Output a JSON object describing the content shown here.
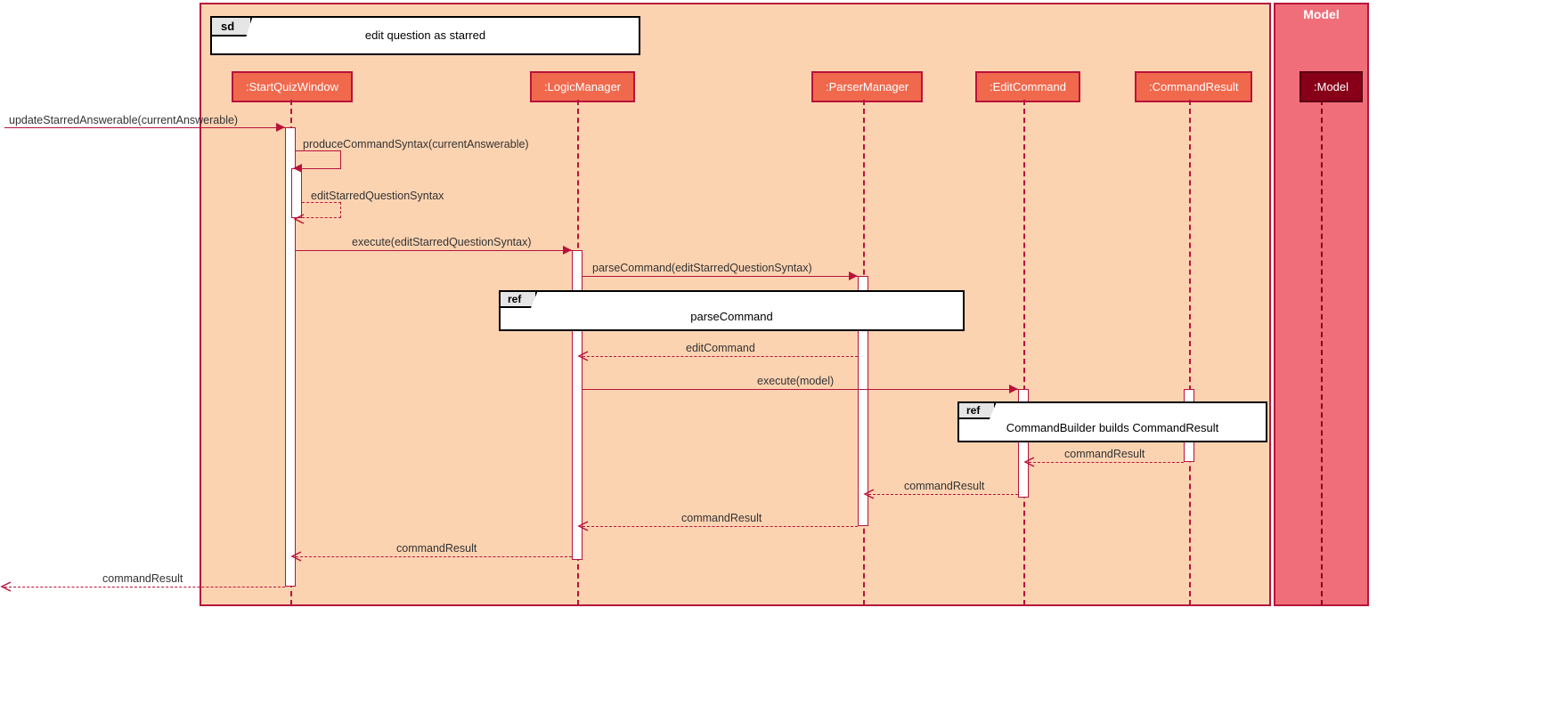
{
  "frames": {
    "sd_tag": "sd",
    "sd_label": "edit question as starred",
    "model_title": "Model",
    "ref1_tag": "ref",
    "ref1_label": "parseCommand",
    "ref2_tag": "ref",
    "ref2_label": "CommandBuilder builds CommandResult"
  },
  "participants": {
    "p1": ":StartQuizWindow",
    "p2": ":LogicManager",
    "p3": ":ParserManager",
    "p4": ":EditCommand",
    "p5": ":CommandResult",
    "p6": ":Model"
  },
  "messages": {
    "m1": "updateStarredAnswerable(currentAnswerable)",
    "m2": "produceCommandSyntax(currentAnswerable)",
    "m3": "editStarredQuestionSyntax",
    "m4": "execute(editStarredQuestionSyntax)",
    "m5": "parseCommand(editStarredQuestionSyntax)",
    "m6": "editCommand",
    "m7": "execute(model)",
    "m8": "commandResult",
    "m9": "commandResult",
    "m10": "commandResult",
    "m11": "commandResult",
    "m12": "commandResult"
  }
}
